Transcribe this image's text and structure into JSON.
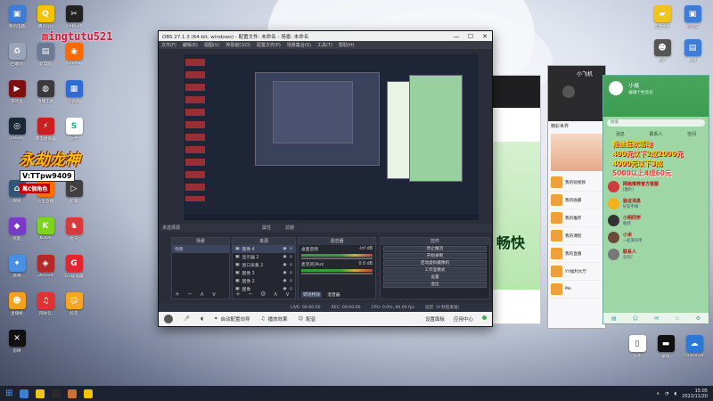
{
  "watermark": "mingtutu521",
  "promo": {
    "title": "永劫龙神",
    "contact": "V:TTpw9409",
    "sub": "萬C個角色"
  },
  "desktop_left": [
    {
      "label": "我的电脑",
      "color": "#3b7dd8",
      "glyph": "▣"
    },
    {
      "label": "腾讯QQ",
      "color": "#f5c400",
      "glyph": "Q"
    },
    {
      "label": "CapCut",
      "color": "#222222",
      "glyph": "✂"
    },
    {
      "label": "回收站",
      "color": "#9aa4b8",
      "glyph": "♻"
    },
    {
      "label": "此电脑",
      "color": "#6b7b93",
      "glyph": "▤"
    },
    {
      "label": "Firefox",
      "color": "#ff6a00",
      "glyph": "◉"
    },
    {
      "label": "游戏盒",
      "color": "#7a1010",
      "glyph": "▶"
    },
    {
      "label": "直播工具",
      "color": "#3a3a3a",
      "glyph": "◍"
    },
    {
      "label": "工具箱",
      "color": "#2e6bd6",
      "glyph": "▦"
    },
    {
      "label": "Steam",
      "color": "#1b2838",
      "glyph": "◎"
    },
    {
      "label": "雷电模拟器",
      "color": "#c82020",
      "glyph": "⚡"
    },
    {
      "label": "文档",
      "color": "#ffffff",
      "glyph": "S"
    },
    {
      "label": "网络",
      "color": "#335577",
      "glyph": "⌂"
    },
    {
      "label": "斗鱼直播",
      "color": "#ff6f00",
      "glyph": "◐"
    },
    {
      "label": "剪辑",
      "color": "#404040",
      "glyph": "▷"
    },
    {
      "label": "优酷",
      "color": "#7a3ac8",
      "glyph": "◆"
    },
    {
      "label": "KOOK",
      "color": "#7ed321",
      "glyph": "K"
    },
    {
      "label": "虎牙",
      "color": "#d63a3a",
      "glyph": "♞"
    },
    {
      "label": "原神",
      "color": "#4a90e2",
      "glyph": "✦"
    },
    {
      "label": "Discord",
      "color": "#b52828",
      "glyph": "◈"
    },
    {
      "label": "GG加速器",
      "color": "#e0262e",
      "glyph": "G"
    },
    {
      "label": "直播姬",
      "color": "#f4a020",
      "glyph": "☻"
    },
    {
      "label": "网易云",
      "color": "#dd3333",
      "glyph": "♫"
    },
    {
      "label": "抖音",
      "color": "#f5a623",
      "glyph": "☺"
    },
    {
      "label": "剪映",
      "color": "#111111",
      "glyph": "✕"
    }
  ],
  "desktop_right": [
    {
      "label": "新建文件",
      "color": "#f0c419",
      "glyph": "▰"
    },
    {
      "label": "此电脑",
      "color": "#3b7dd8",
      "glyph": "▣"
    },
    {
      "label": "用户",
      "color": "#555555",
      "glyph": "☻"
    },
    {
      "label": "网络",
      "color": "#3b7dd8",
      "glyph": "▤"
    },
    {
      "label": "文件",
      "color": "#ffffff",
      "glyph": "▯"
    },
    {
      "label": "录屏",
      "color": "#111111",
      "glyph": "▬"
    },
    {
      "label": "OneDrive",
      "color": "#2b78d6",
      "glyph": "☁"
    }
  ],
  "obs": {
    "title": "OBS 27.1.3 (64-bit, windows) - 配置文件: 未命名 - 场景: 未命名",
    "window_controls": [
      "—",
      "☐",
      "✕"
    ],
    "menu": [
      "文件(F)",
      "编辑(E)",
      "视图(V)",
      "停靠窗口(D)",
      "配置文件(P)",
      "场景集合(S)",
      "工具(T)",
      "帮助(H)"
    ],
    "sep_left": "未选择源",
    "sep_props": "属性",
    "sep_filters": "滤镜",
    "docks": {
      "scenes": {
        "title": "场景",
        "items": [
          "场景"
        ]
      },
      "sources": {
        "title": "来源",
        "items": [
          "图像 4",
          "显示器 2",
          "窗口采集 2",
          "图像 3",
          "图像 2",
          "图像"
        ]
      },
      "mixer": {
        "title": "混音器",
        "ch1": "桌面音频",
        "ch1_db": "-inf dB",
        "ch2": "麦克风/Aux",
        "ch2_db": "0.0 dB",
        "tab_transition": "转场特效",
        "tab_mixer": "混音器"
      },
      "controls": {
        "title": "控件",
        "buttons": [
          "停止推流",
          "开始录制",
          "启动虚拟摄像机",
          "工作室模式",
          "设置",
          "退出"
        ]
      }
    },
    "status": {
      "live": "LIVE: 00:00:00",
      "rec": "REC: 00:00:00",
      "cpu": "CPU: 0.0%, 60.00 fps",
      "delay": "延迟（0 秒后发送）"
    },
    "bottom_tools": [
      "自动配置向导",
      "播放效果",
      "配音"
    ],
    "bottom_right": [
      "设置面板",
      "应用中心"
    ]
  },
  "music": {
    "banner_text": "畅快"
  },
  "phone": {
    "title": "小飞机",
    "section": "精彩世界",
    "items": [
      "我的短视频",
      "我的收藏",
      "我的推荐",
      "我的课程",
      "我的直播",
      "YY福利大厅",
      "Me"
    ]
  },
  "qq": {
    "user": "小易",
    "subtitle": "编辑个性签名",
    "search_placeholder": "搜索",
    "tabs": [
      "消息",
      "联系人",
      "空间"
    ],
    "ad_lines": [
      {
        "text": "粉丝狂欢活动",
        "red": false
      },
      {
        "text": "400元以下2成2000元",
        "red": false
      },
      {
        "text": "4000元以下3成",
        "red": false
      },
      {
        "text": "5000以上4成60元",
        "red": true
      }
    ],
    "chats": [
      {
        "name": "网络推荐官方客服",
        "msg": "[图片]",
        "color": "#d03c3c"
      },
      {
        "name": "验证消息",
        "msg": "好友申请",
        "color": "#f2b21a"
      },
      {
        "name": "小明同学",
        "msg": "收到",
        "color": "#333333"
      },
      {
        "name": "小米",
        "msg": "一起来玩吧",
        "color": "#6a4a3a"
      },
      {
        "name": "联系人",
        "msg": "在吗？",
        "color": "#777777"
      }
    ],
    "foot_icons": [
      "▤",
      "☺",
      "✉",
      "☆",
      "⚙"
    ]
  },
  "taskbar": {
    "apps": [
      "#3b7dd8",
      "#f0c419",
      "#2a2a2a",
      "#d07030",
      "#f5c400"
    ],
    "time": "15:05",
    "date": "2022/11/20"
  }
}
